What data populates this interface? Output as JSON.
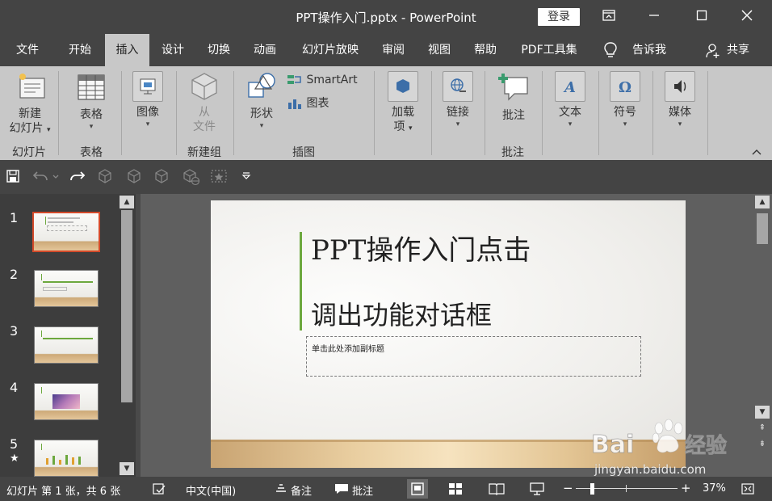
{
  "window": {
    "title": "PPT操作入门.pptx  -  PowerPoint",
    "login_label": "登录",
    "controls": [
      "restore-ribbon",
      "minimize",
      "maximize",
      "close"
    ]
  },
  "tabs": [
    {
      "label": "文件"
    },
    {
      "label": "开始"
    },
    {
      "label": "插入",
      "active": true
    },
    {
      "label": "设计"
    },
    {
      "label": "切换"
    },
    {
      "label": "动画"
    },
    {
      "label": "幻灯片放映"
    },
    {
      "label": "审阅"
    },
    {
      "label": "视图"
    },
    {
      "label": "帮助"
    },
    {
      "label": "PDF工具集"
    }
  ],
  "tell_me": "告诉我",
  "share": "共享",
  "ribbon": {
    "new_slide": {
      "line1": "新建",
      "line2": "幻灯片"
    },
    "table": "表格",
    "image": "图像",
    "from_file": {
      "line1": "从",
      "line2": "文件"
    },
    "shapes": "形状",
    "smartart": "SmartArt",
    "chart": "图表",
    "addins": {
      "line1": "加载",
      "line2": "项"
    },
    "link": "链接",
    "comment": "批注",
    "text": "文本",
    "symbol": "符号",
    "media": "媒体",
    "groups": {
      "slides": "幻灯片",
      "tables": "表格",
      "new_group": "新建组",
      "illustrations": "插图",
      "comments": "批注"
    }
  },
  "thumbnails": [
    {
      "num": "1",
      "selected": true
    },
    {
      "num": "2"
    },
    {
      "num": "3"
    },
    {
      "num": "4"
    },
    {
      "num": "5",
      "has_animation": true
    }
  ],
  "slide": {
    "title_line1": "PPT操作入门点击",
    "title_line2": "调出功能对话框",
    "subtitle_placeholder": "单击此处添加副标题"
  },
  "status": {
    "slide_info": "幻灯片 第 1 张，共 6 张",
    "language": "中文(中国)",
    "notes": "备注",
    "comments": "批注",
    "zoom": "37%"
  },
  "watermark": {
    "brand": "Bai度经验",
    "url": "jingyan.baidu.com"
  },
  "colors": {
    "chrome": "#444444",
    "ribbon": "#c8c8c8",
    "accent_selection": "#d34a2a",
    "slide_green": "#6ca83e"
  }
}
